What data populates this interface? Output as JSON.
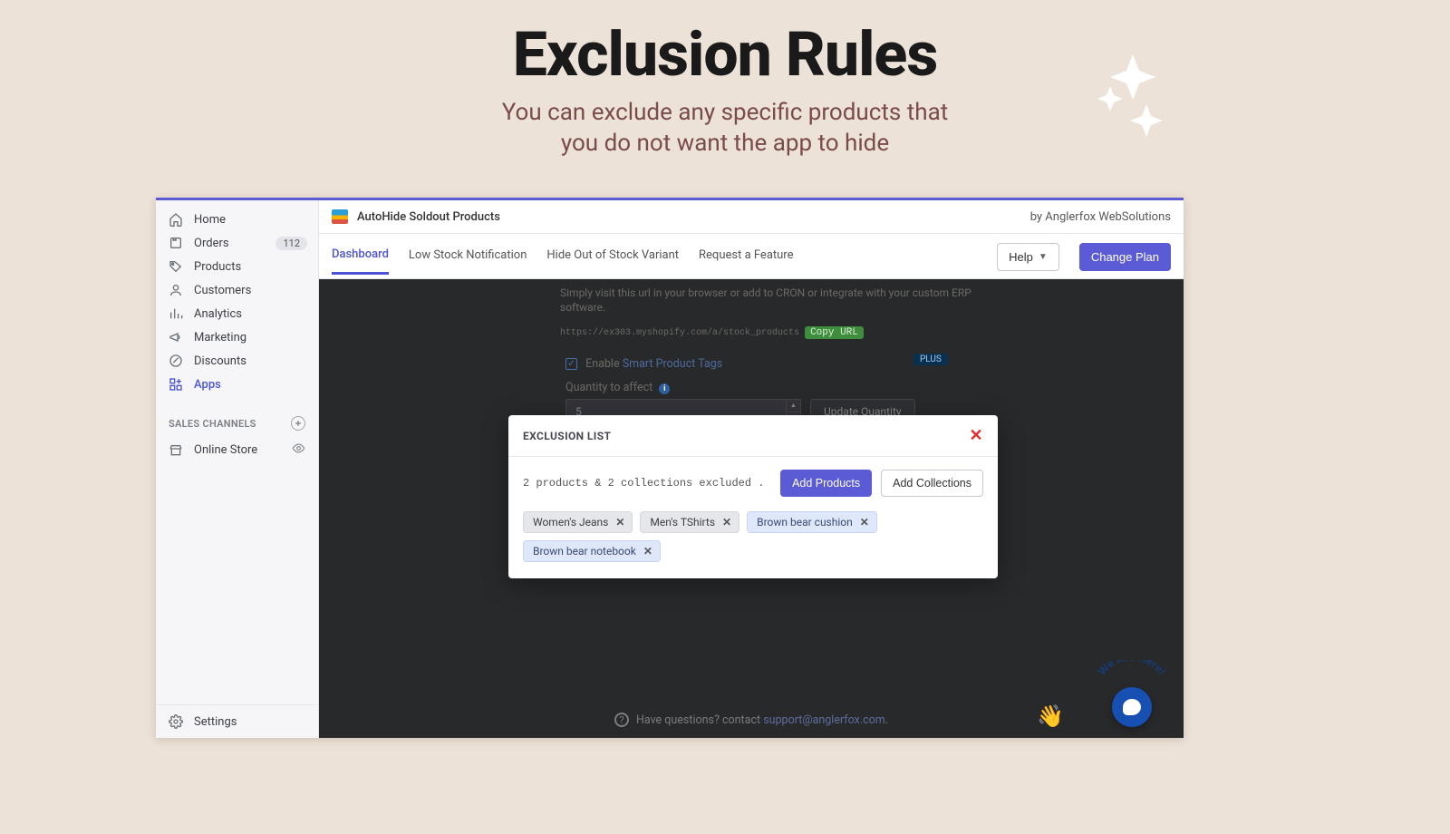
{
  "hero": {
    "title": "Exclusion Rules",
    "sub1": "You can exclude any specific products that",
    "sub2": "you do not want the app to hide"
  },
  "sidebar": {
    "home": "Home",
    "orders": "Orders",
    "orders_badge": "112",
    "products": "Products",
    "customers": "Customers",
    "analytics": "Analytics",
    "marketing": "Marketing",
    "discounts": "Discounts",
    "apps": "Apps",
    "channels_heading": "SALES CHANNELS",
    "online_store": "Online Store",
    "settings": "Settings"
  },
  "header": {
    "app_name": "AutoHide Soldout Products",
    "by": "by Anglerfox WebSolutions"
  },
  "tabs": {
    "dashboard": "Dashboard",
    "lowstock": "Low Stock Notification",
    "hidevariant": "Hide Out of Stock Variant",
    "request": "Request a Feature",
    "help": "Help",
    "change_plan": "Change Plan"
  },
  "dim": {
    "line1": "Simply visit this url in your browser or add to CRON or integrate with your custom ERP",
    "line2": "software.",
    "url": "https://ex303.myshopify.com/a/stock_products",
    "copy": "Copy URL",
    "enable": "Enable",
    "smart_tags": "Smart Product Tags",
    "plus": "PLUS",
    "qty_label": "Quantity to affect",
    "qty_value": "5",
    "update_qty": "Update Quantity"
  },
  "modal": {
    "title": "EXCLUSION LIST",
    "summary": "2 products & 2 collections excluded .",
    "add_products": "Add Products",
    "add_collections": "Add Collections",
    "chips": {
      "c0": "Women's Jeans",
      "c1": "Men's TShirts",
      "c2": "Brown bear cushion",
      "c3": "Brown bear notebook"
    }
  },
  "footer": {
    "q": "Have questions? contact ",
    "email": "support@anglerfox.com",
    "dot": "."
  },
  "chat": {
    "arc": "We Are Here!"
  }
}
